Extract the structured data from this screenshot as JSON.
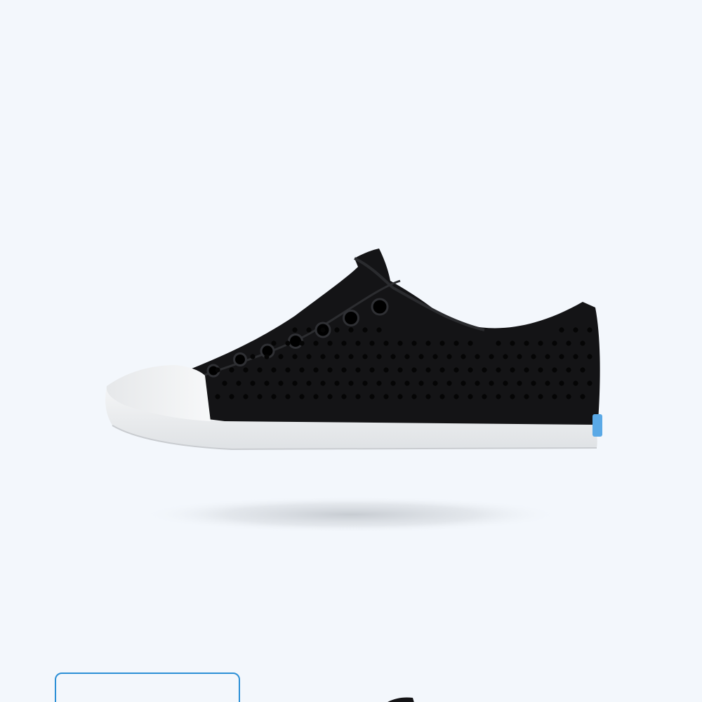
{
  "product": {
    "image_icon": "sneaker-image",
    "colors": {
      "background": "#f3f7fc",
      "upper": "#141416",
      "sole": "#eef0f2",
      "tab": "#5aa9e6",
      "thumb_border": "#2b8fd6"
    }
  },
  "gallery": {
    "thumbnails": [
      {
        "icon": "sneaker-thumbnail",
        "selected": true
      },
      {
        "icon": "sneaker-thumbnail",
        "selected": false
      }
    ]
  }
}
